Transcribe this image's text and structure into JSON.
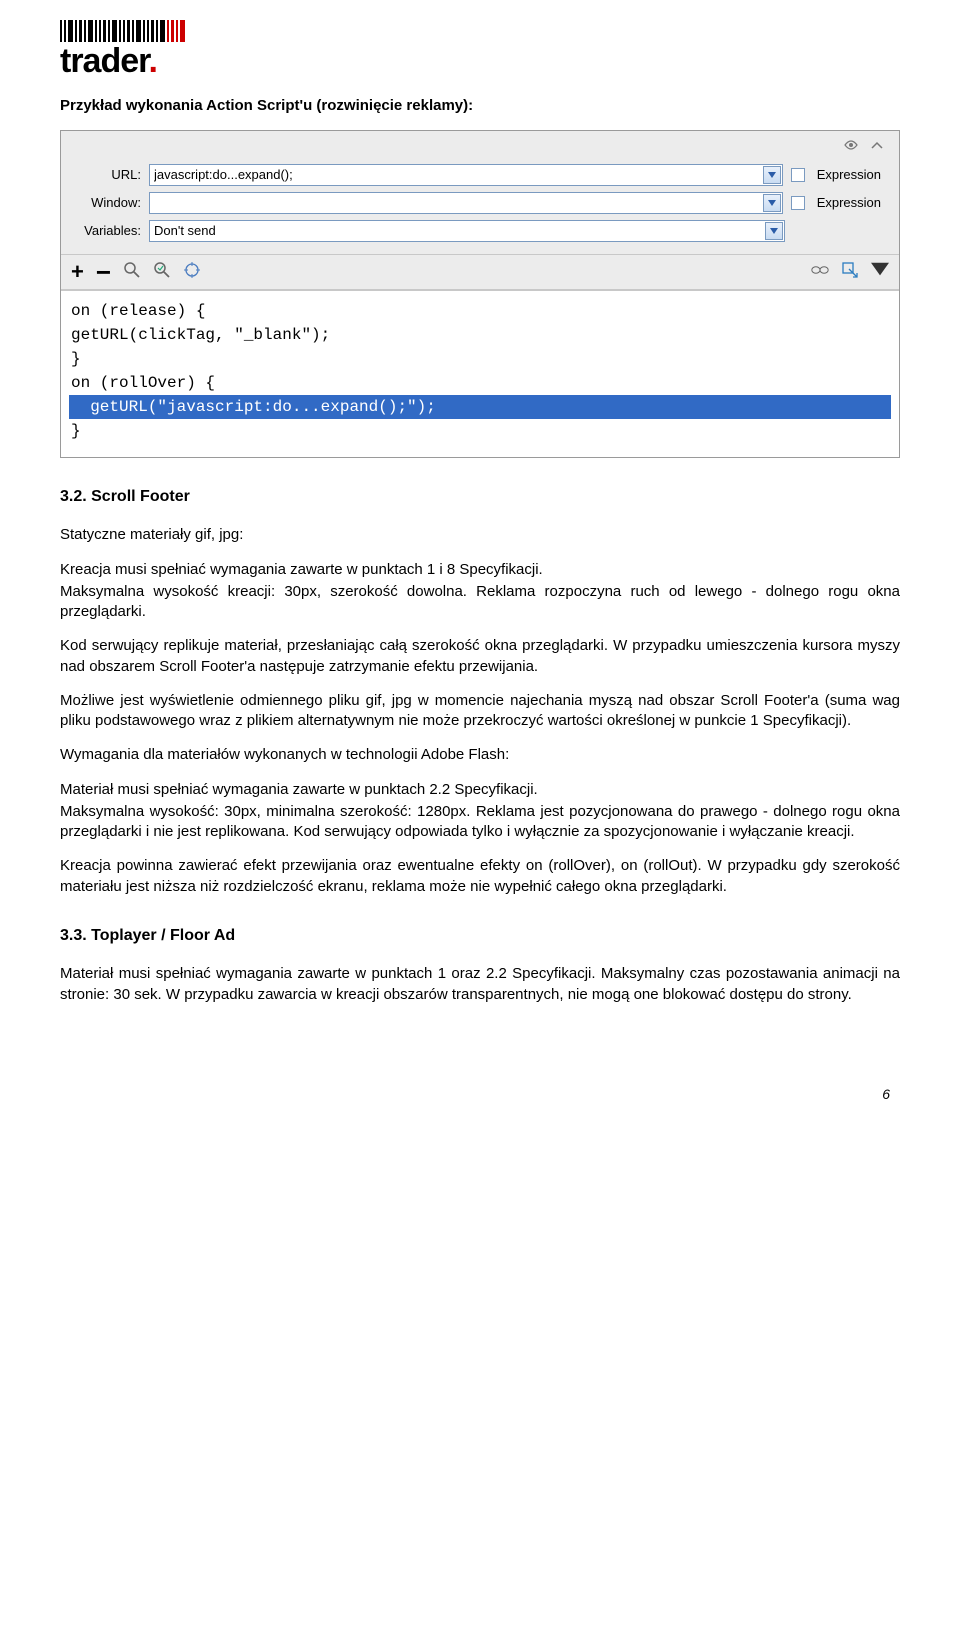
{
  "logo": {
    "text_main": "trader",
    "text_dot": "."
  },
  "intro": "Przykład wykonania Action Script'u (rozwinięcie reklamy):",
  "panel": {
    "url_label": "URL:",
    "url_value": "javascript:do...expand();",
    "window_label": "Window:",
    "window_value": "",
    "variables_label": "Variables:",
    "variables_value": "Don't send",
    "expression_label": "Expression",
    "code": {
      "l1": "on (release) {",
      "l2": "getURL(clickTag, \"_blank\");",
      "l3": "}",
      "l4": "on (rollOver) {",
      "l5": "  getURL(\"javascript:do...expand();\");",
      "l6": "}"
    }
  },
  "s32": {
    "heading": "3.2. Scroll Footer",
    "p1": "Statyczne materiały gif, jpg:",
    "p2": "Kreacja musi spełniać wymagania zawarte w punktach 1 i 8 Specyfikacji.",
    "p3": "Maksymalna wysokość kreacji: 30px, szerokość dowolna. Reklama rozpoczyna ruch od lewego - dolnego rogu okna przeglądarki.",
    "p4": "Kod serwujący replikuje materiał, przesłaniając całą szerokość okna przeglądarki. W przypadku umieszczenia kursora myszy nad obszarem Scroll Footer'a następuje zatrzymanie efektu przewijania.",
    "p5": "Możliwe jest wyświetlenie odmiennego pliku gif, jpg w momencie najechania myszą nad obszar Scroll Footer'a (suma wag pliku podstawowego wraz z plikiem alternatywnym nie może przekroczyć wartości określonej w punkcie 1 Specyfikacji).",
    "p6": "Wymagania dla materiałów wykonanych w technologii Adobe Flash:",
    "p7": "Materiał musi spełniać wymagania zawarte w punktach 2.2 Specyfikacji.",
    "p8": "Maksymalna wysokość: 30px, minimalna szerokość: 1280px. Reklama jest pozycjonowana do prawego - dolnego rogu okna przeglądarki i nie jest replikowana. Kod serwujący odpowiada tylko i wyłącznie za spozycjonowanie i wyłączanie kreacji.",
    "p9": "Kreacja powinna zawierać efekt przewijania oraz ewentualne efekty on (rollOver), on (rollOut). W przypadku gdy szerokość materiału jest niższa niż rozdzielczość ekranu, reklama może nie wypełnić całego okna przeglądarki."
  },
  "s33": {
    "heading": "3.3. Toplayer / Floor Ad",
    "p1": "Materiał musi spełniać wymagania zawarte w punktach 1 oraz 2.2 Specyfikacji. Maksymalny czas pozostawania animacji na stronie: 30 sek. W przypadku zawarcia w kreacji obszarów transparentnych, nie mogą one blokować dostępu do strony."
  },
  "page_number": "6"
}
